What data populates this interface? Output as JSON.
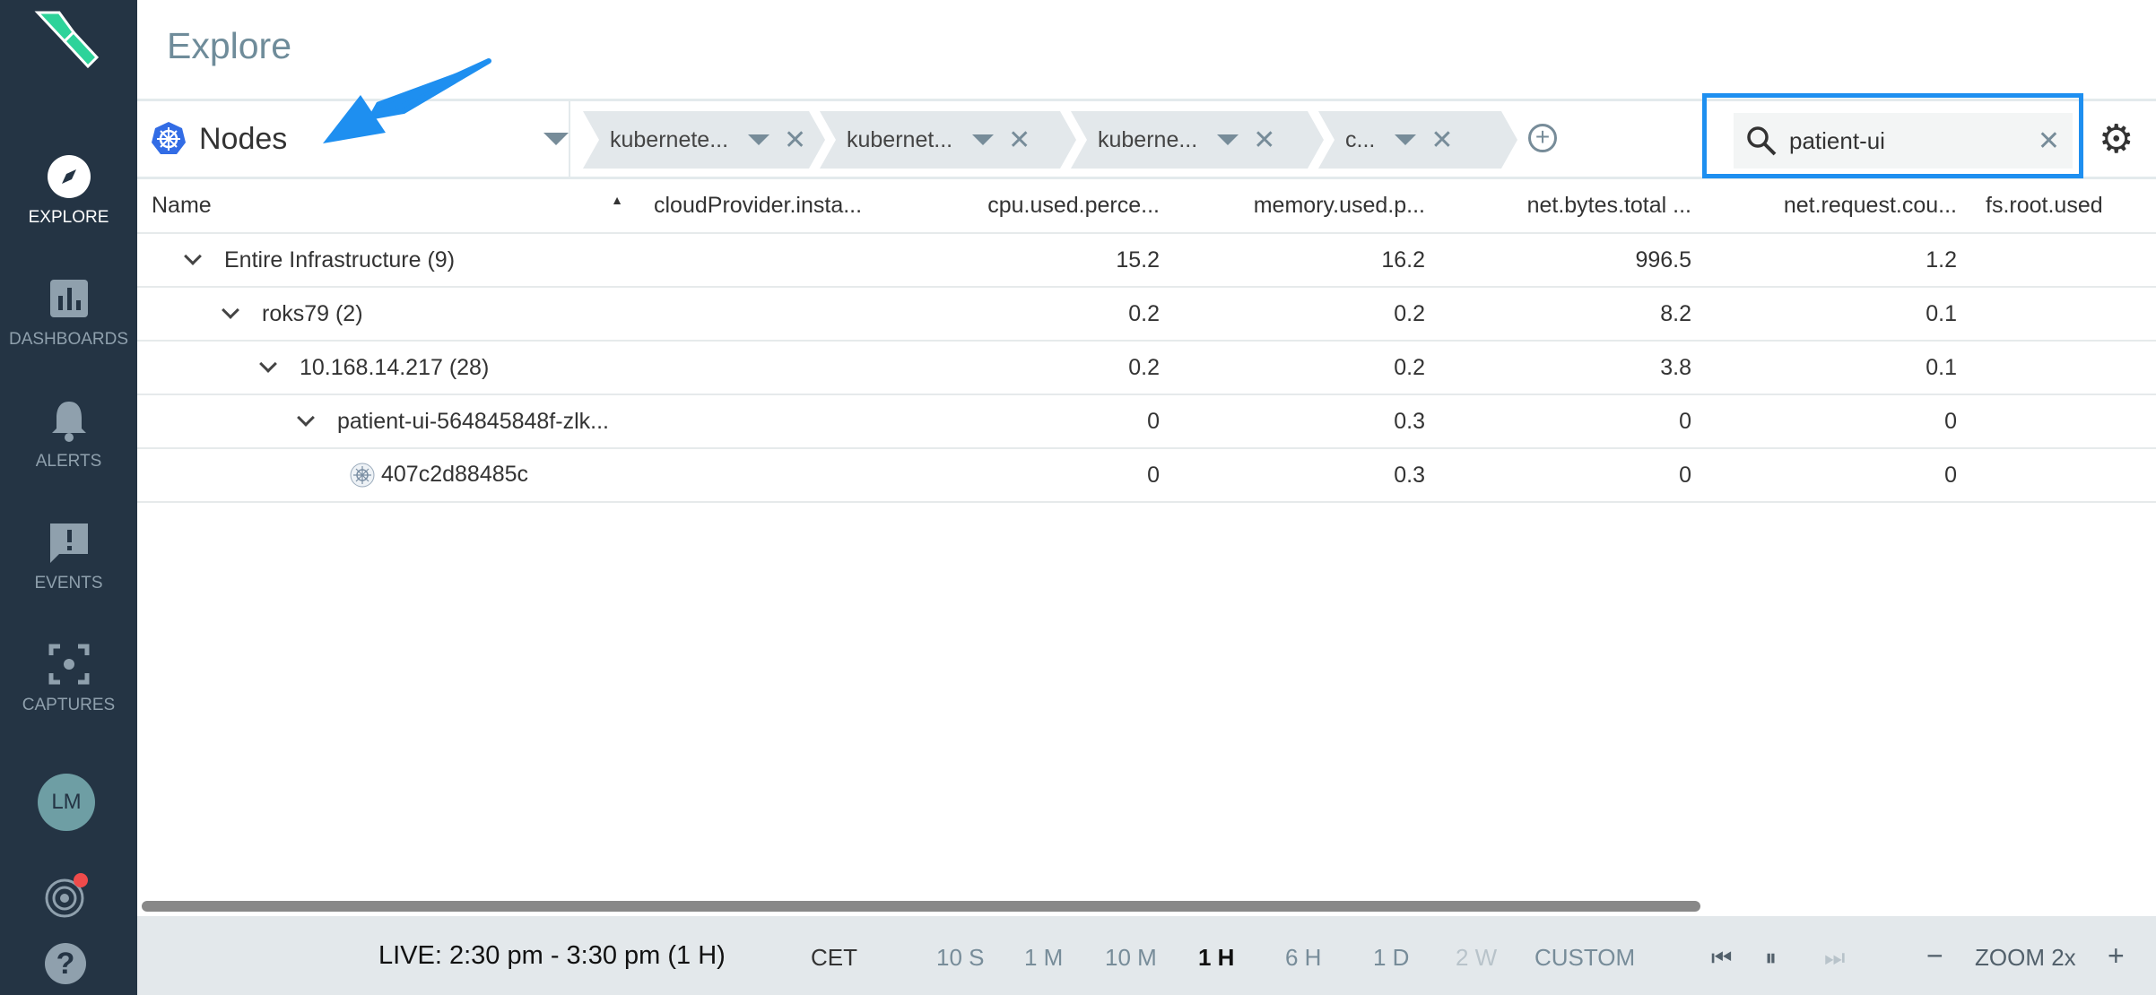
{
  "sidebar": {
    "items": [
      {
        "label": "EXPLORE",
        "icon": "compass-icon",
        "active": true
      },
      {
        "label": "DASHBOARDS",
        "icon": "bar-chart-icon"
      },
      {
        "label": "ALERTS",
        "icon": "bell-icon"
      },
      {
        "label": "EVENTS",
        "icon": "event-icon"
      },
      {
        "label": "CAPTURES",
        "icon": "capture-icon"
      }
    ],
    "avatar": "LM"
  },
  "header": {
    "title": "Explore"
  },
  "scope": {
    "label": "Nodes",
    "icon": "kubernetes-icon"
  },
  "breadcrumbs": [
    "kubernete...",
    "kubernet...",
    "kuberne...",
    "c..."
  ],
  "search": {
    "value": "patient-ui"
  },
  "table": {
    "columns": [
      "Name",
      "cloudProvider.insta...",
      "cpu.used.perce...",
      "memory.used.p...",
      "net.bytes.total ...",
      "net.request.cou...",
      "fs.root.used"
    ],
    "rows": [
      {
        "name": "Entire Infrastructure (9)",
        "values": [
          "",
          "15.2",
          "16.2",
          "996.5",
          "1.2",
          ""
        ]
      },
      {
        "name": "roks79 (2)",
        "values": [
          "",
          "0.2",
          "0.2",
          "8.2",
          "0.1",
          ""
        ]
      },
      {
        "name": "10.168.14.217 (28)",
        "values": [
          "",
          "0.2",
          "0.2",
          "3.8",
          "0.1",
          ""
        ]
      },
      {
        "name": "patient-ui-564845848f-zlk...",
        "values": [
          "",
          "0",
          "0.3",
          "0",
          "0",
          ""
        ]
      },
      {
        "name": "407c2d88485c",
        "values": [
          "",
          "0",
          "0.3",
          "0",
          "0",
          ""
        ]
      }
    ]
  },
  "timebar": {
    "live": "LIVE: 2:30 pm - 3:30 pm (1 H)",
    "tz": "CET",
    "ranges": [
      "10 S",
      "1 M",
      "10 M",
      "1 H",
      "6 H",
      "1 D",
      "2 W",
      "CUSTOM"
    ],
    "selected": "1 H",
    "zoom": "ZOOM 2x",
    "accent": "#1e8ff0"
  }
}
